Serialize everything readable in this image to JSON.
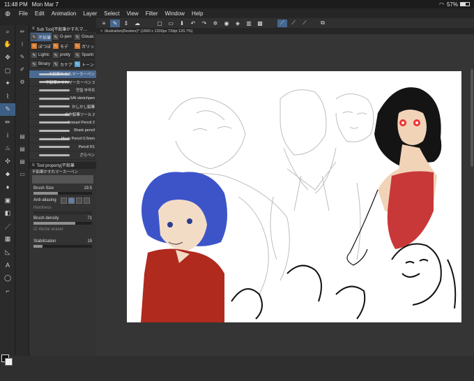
{
  "status": {
    "time": "11:48 PM",
    "date": "Mon Mar 7",
    "battery": "57%",
    "wifi_icon": "wifi-icon"
  },
  "menu": [
    "File",
    "Edit",
    "Animation",
    "Layer",
    "Select",
    "View",
    "Filter",
    "Window",
    "Help"
  ],
  "subtool": {
    "header": "Sub Tool[不鉛筆かすれマ…",
    "tabs": [
      {
        "label": "不鉛筆",
        "selected": true,
        "icon": "pencil-icon"
      },
      {
        "label": "G-pen",
        "selected": false,
        "icon": "pen-icon"
      },
      {
        "label": "Gouac",
        "selected": false,
        "icon": "brush-icon"
      },
      {
        "label": "ぼつぼ",
        "selected": false,
        "icon": "pencil-icon",
        "accent": "#d8792c"
      },
      {
        "label": "モデ",
        "selected": false,
        "icon": "pencil-icon",
        "accent": "#d8792c"
      },
      {
        "label": "ガリっ",
        "selected": false,
        "icon": "pencil-icon",
        "accent": "#d8792c"
      },
      {
        "label": "Lightc",
        "selected": false,
        "icon": "brush-icon"
      },
      {
        "label": "pretty",
        "selected": false,
        "icon": "brush-icon"
      },
      {
        "label": "Sparkl",
        "selected": false,
        "icon": "sparkle-icon"
      },
      {
        "label": "Binary",
        "selected": false,
        "icon": "brush-icon"
      },
      {
        "label": "カケア",
        "selected": false,
        "icon": "brush-icon"
      },
      {
        "label": "トーン",
        "selected": false,
        "icon": "tone-icon",
        "accent": "#5aa6d9"
      }
    ],
    "brushes": [
      {
        "label": "不鉛筆かすれマーカーペン",
        "selected": true
      },
      {
        "label": "不鉛筆かすれマーカーペン 2",
        "selected": false
      },
      {
        "label": "연필 부라쉬",
        "selected": false
      },
      {
        "label": "SAI sketchpen",
        "selected": false
      },
      {
        "label": "かしかし鉛筆",
        "selected": false
      },
      {
        "label": "自作鉛筆ツール 2",
        "selected": false
      },
      {
        "label": "Smeart Pencil 2",
        "selected": false
      },
      {
        "label": "Shark pencil",
        "selected": false
      },
      {
        "label": "Mech Pencil 0.5mm",
        "selected": false
      },
      {
        "label": "Pencil R1",
        "selected": false
      },
      {
        "label": "ざらペン",
        "selected": false
      }
    ]
  },
  "toolprop": {
    "header": "Tool property[不鉛筆",
    "name": "不鉛筆かすれマーカーペン",
    "brush_size_label": "Brush Size",
    "brush_size_value": "19.5",
    "brush_size_level": 0.42,
    "anti_aliasing_label": "Anti-aliasing",
    "hardness_label": "Hardness",
    "brush_density_label": "Brush density",
    "brush_density_value": "71",
    "brush_density_level": 0.71,
    "vector_eraser_label": "Vector eraser",
    "stabilization_label": "Stabilization",
    "stabilization_value": "15"
  },
  "document": {
    "tab_title": "illustration(Restore)* (1600 x 1200px 72dpi 120.7%)"
  },
  "colors": {
    "main": "#111111",
    "sub": "#f2f2f2",
    "accent": "#466790"
  }
}
